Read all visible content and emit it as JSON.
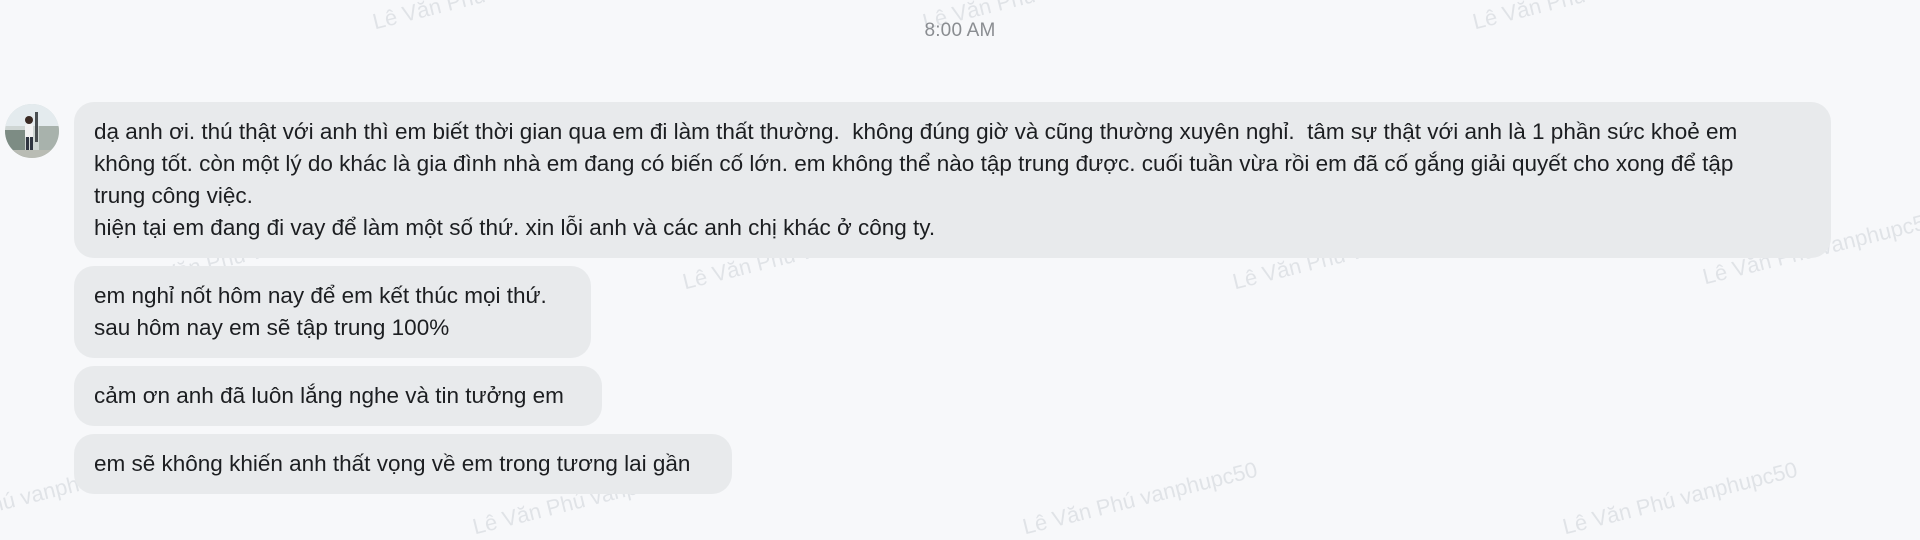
{
  "conversation": {
    "timestamp": "8:00 AM",
    "messages": [
      "dạ anh ơi. thú thật với anh thì em biết thời gian qua em đi làm thất thường.  không đúng giờ và cũng thường xuyên nghỉ.  tâm sự thật với anh là 1 phần sức khoẻ em\nkhông tốt. còn một lý do khác là gia đình nhà em đang có biến cố lớn. em không thể nào tập trung được. cuối tuần vừa rồi em đã cố gắng giải quyết cho xong để tập\ntrung công việc.\nhiện tại em đang đi vay để làm một số thứ. xin lỗi anh và các anh chị khác ở công ty.",
      "em nghỉ nốt hôm nay để em kết thúc mọi thứ.\nsau hôm nay em sẽ tập trung 100%",
      "cảm ơn anh đã luôn lắng nghe và tin tưởng em",
      "em sẽ không khiến anh thất vọng về em trong tương lai gần"
    ]
  },
  "watermark": {
    "text": "Lê Văn Phú vanphupc50"
  },
  "icons": {
    "avatar": "user-avatar-photo"
  },
  "colors": {
    "background": "#f7f8fa",
    "bubble": "#e8eaec",
    "text": "#1c1e21",
    "timestamp": "#8a8d91"
  }
}
